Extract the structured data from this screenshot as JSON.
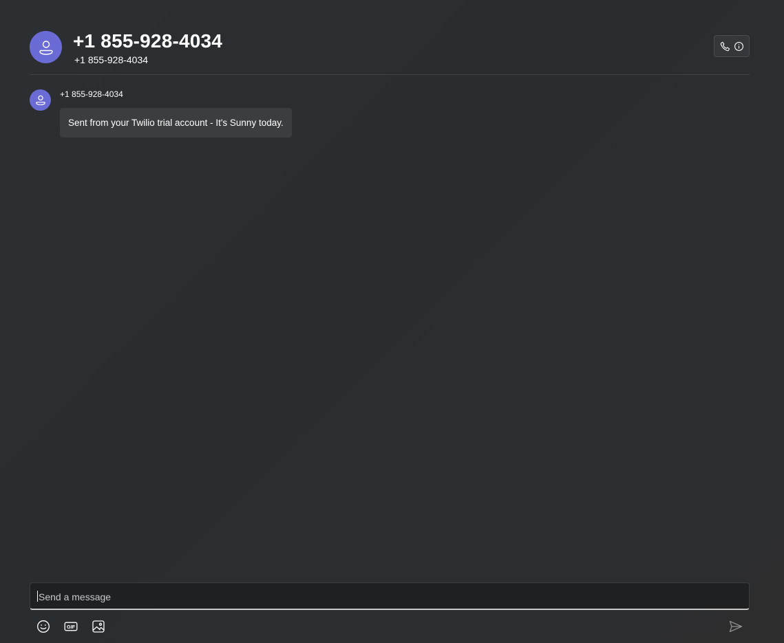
{
  "header": {
    "title": "+1 855-928-4034",
    "subtitle": "+1 855-928-4034",
    "avatar_icon": "person-icon",
    "actions": [
      {
        "icon": "phone-icon"
      },
      {
        "icon": "info-icon"
      }
    ]
  },
  "messages": [
    {
      "sender": "+1 855-928-4034",
      "text": "Sent from your Twilio trial account - It's Sunny today.",
      "avatar_icon": "person-icon"
    }
  ],
  "composer": {
    "placeholder": "Send a message",
    "value": ""
  },
  "toolbar": {
    "buttons": [
      {
        "icon": "emoji-icon"
      },
      {
        "icon": "gif-icon",
        "label": "GIF"
      },
      {
        "icon": "image-icon"
      }
    ],
    "send_icon": "send-icon"
  },
  "colors": {
    "accent": "#6b6bd6",
    "background": "#2b2d2f",
    "bubble": "#3b3d3f"
  }
}
